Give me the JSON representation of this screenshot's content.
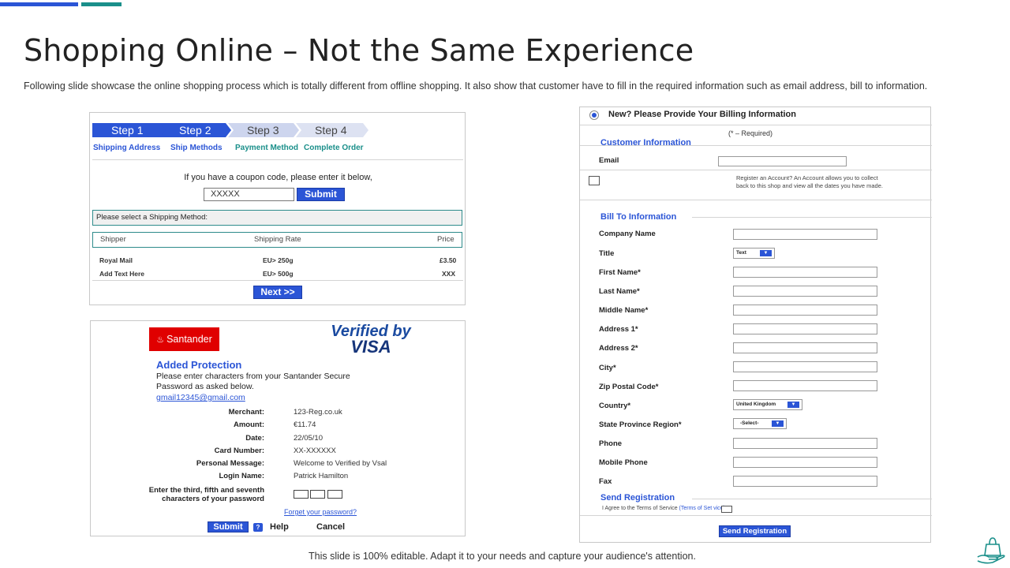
{
  "slide": {
    "title": "Shopping Online – Not the Same Experience",
    "subtitle": "Following slide showcase the online shopping process which is totally different  from offline shopping. It also show that customer have to fill in the required  information  such as email address, bill to information.",
    "footer": "This slide is 100% editable. Adapt it to your needs and capture your audience's attention.",
    "accent_colors": {
      "blue": "#2b55d6",
      "teal": "#1a8f8a",
      "santander_red": "#e00000"
    }
  },
  "checkout": {
    "steps": [
      {
        "label": "Step 1",
        "sublabel": "Shipping Address",
        "status": "complete"
      },
      {
        "label": "Step 2",
        "sublabel": "Ship Methods",
        "status": "current"
      },
      {
        "label": "Step 3",
        "sublabel": "Payment Method",
        "status": "pending"
      },
      {
        "label": "Step 4",
        "sublabel": "Complete Order",
        "status": "pending"
      }
    ],
    "coupon_prompt": "If you have a coupon code, please enter it below,",
    "coupon_value": "XXXXX",
    "submit_label": "Submit",
    "shipping_select_label": "Please select a Shipping Method:",
    "table_headers": [
      "Shipper",
      "Shipping  Rate",
      "Price"
    ],
    "rows": [
      [
        "Royal  Mail",
        "EU> 250g",
        "£3.50"
      ],
      [
        "Add Text Here",
        "EU> 500g",
        "XXX"
      ]
    ],
    "next_label": "Next >>"
  },
  "bank": {
    "santander_label": "Santander",
    "verified_line1": "Verified by",
    "verified_line2": "VISA",
    "protection_title": "Added Protection",
    "protection_text": "Please enter characters from your Santander Secure Password as asked below.",
    "email": "gmail12345@gmail.com",
    "details": [
      {
        "label": "Merchant:",
        "value": "123-Reg.co.uk"
      },
      {
        "label": "Amount:",
        "value": "€11.74"
      },
      {
        "label": "Date:",
        "value": "22/05/10"
      },
      {
        "label": "Card Number:",
        "value": "XX-XXXXXX"
      },
      {
        "label": "Personal Message:",
        "value": "Welcome to Verified by Vsal"
      },
      {
        "label": "Login Name:",
        "value": "Patrick Hamilton"
      }
    ],
    "password_prompt_line1": "Enter the third, fifth and seventh",
    "password_prompt_line2": "characters of your password",
    "forgot_link": "Forget your password?",
    "submit_label": "Submit",
    "help_icon_text": "?",
    "help_label": "Help",
    "cancel_label": "Cancel"
  },
  "billing": {
    "header": "New? Please Provide Your Billing Information",
    "required_note": "(* – Required)",
    "customer_info_title": "Customer Information",
    "email_label": "Email",
    "register_text": "Register an Account? An Account allows you to collect back to this shop and view all the dates you have made.",
    "bill_to_title": "Bill To Information",
    "fields": {
      "company_name": "Company Name",
      "title": "Title",
      "title_value": "Text",
      "first_name": "First Name*",
      "last_name": "Last Name*",
      "middle_name": "Middle Name*",
      "address1": "Address  1*",
      "address2": "Address  2*",
      "city": "City*",
      "zip": "Zip Postal Code*",
      "country": "Country*",
      "country_value": "United Kingdom",
      "state": "State Province Region*",
      "state_value": "-Select-",
      "phone": "Phone",
      "mobile": "Mobile Phone",
      "fax": "Fax"
    },
    "send_reg_title": "Send Registration",
    "agree_text": "I Agree to the Terms of Service ",
    "agree_link": "(Terms of Set vice)*",
    "send_button": "Send Registration",
    "dropdown_glyph": "▼"
  }
}
